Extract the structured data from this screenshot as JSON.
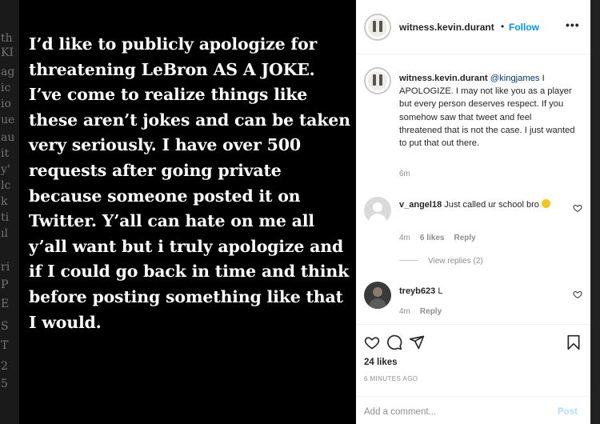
{
  "background_fragments": [
    "th",
    "KI",
    "ag",
    "ic",
    "io",
    "ue",
    "au",
    "it",
    "y'",
    "lc",
    "k",
    "ti",
    "ıl",
    "ri",
    "P",
    "E",
    "S",
    "T",
    "2",
    "5"
  ],
  "post_image": {
    "text": "I’d like to publicly apologize for threatening LeBron AS A JOKE. I’ve come to realize things like these aren’t jokes and can be taken very seriously. I have over 500 requests after going private because someone posted it on Twitter. Y’all can hate on me all y’all want but i truly apologize and if I could go back in time and think before posting something like that I would."
  },
  "header": {
    "username": "witness.kevin.durant",
    "dot": "•",
    "follow_label": "Follow",
    "more_label": "•••"
  },
  "caption": {
    "username": "witness.kevin.durant",
    "mention": "@kingjames",
    "text": " I APOLOGIZE. I may not like you as a player but every person deserves respect. If you somehow saw that tweet and feel threatened that is not the case. I just wanted to put that out there.",
    "time": "6m"
  },
  "comments": [
    {
      "username": "v_angel18",
      "text": " Just called ur school bro ",
      "emoji": "laughing-emoji",
      "time": "4m",
      "likes": "6 likes",
      "reply": "Reply"
    },
    {
      "username": "treyb623",
      "text": " L",
      "time": "4m",
      "reply": "Reply"
    }
  ],
  "view_replies": "View replies (2)",
  "actions": {
    "icons": [
      "heart-icon",
      "comment-icon",
      "share-icon",
      "bookmark-icon"
    ],
    "likes": "24 likes",
    "time_ago": "6 MINUTES AGO"
  },
  "add_comment": {
    "placeholder": "Add a comment...",
    "post_label": "Post"
  },
  "colors": {
    "link_blue": "#0095f6",
    "text": "#262626",
    "muted": "#8e8e8e"
  }
}
